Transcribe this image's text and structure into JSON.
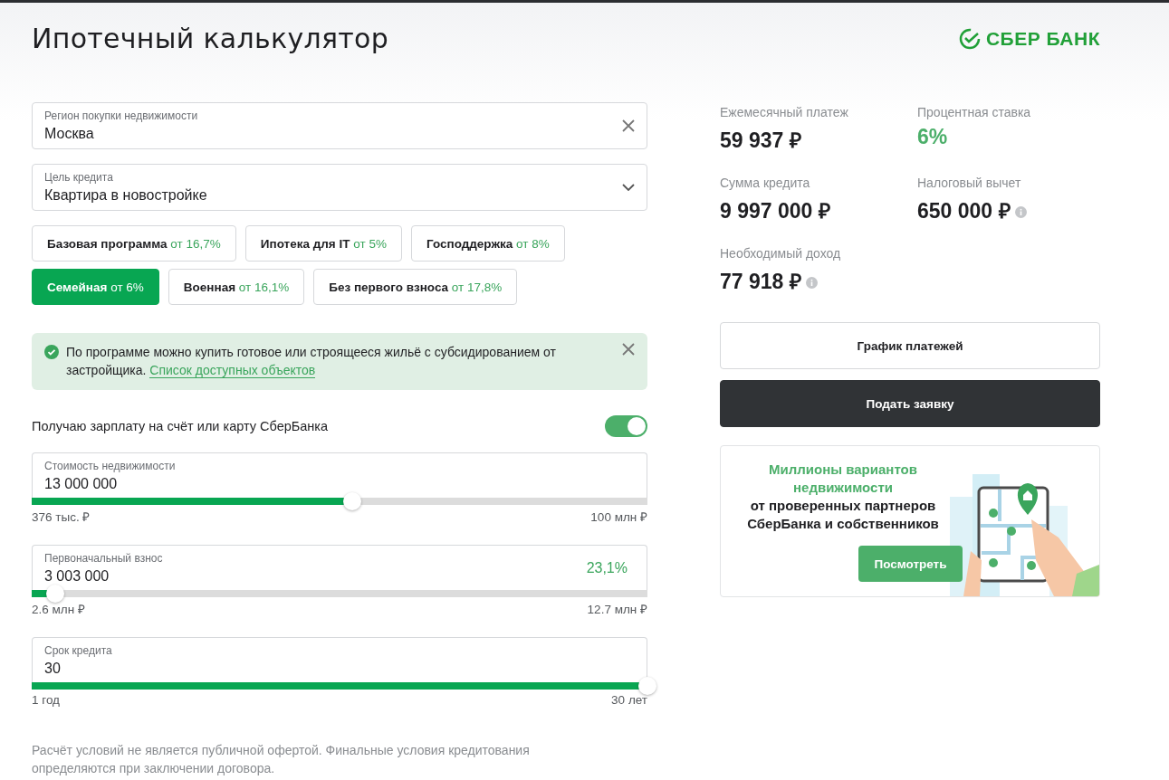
{
  "header": {
    "title": "Ипотечный калькулятор",
    "logo": "СБЕР БАНК"
  },
  "region_field": {
    "label": "Регион покупки недвижимости",
    "value": "Москва"
  },
  "purpose_field": {
    "label": "Цель кредита",
    "value": "Квартира в новостройке"
  },
  "programs": [
    {
      "name": "Базовая программа",
      "rate": "от 16,7%",
      "selected": false
    },
    {
      "name": "Ипотека для IT",
      "rate": "от 5%",
      "selected": false
    },
    {
      "name": "Господдержка",
      "rate": "от 8%",
      "selected": false
    },
    {
      "name": "Семейная",
      "rate": "от 6%",
      "selected": true
    },
    {
      "name": "Военная",
      "rate": "от 16,1%",
      "selected": false
    },
    {
      "name": "Без первого взноса",
      "rate": "от 17,8%",
      "selected": false
    }
  ],
  "notice": {
    "text": "По программе можно купить готовое или строящееся жильё с субсидированием от застройщика.",
    "link": "Список доступных объектов"
  },
  "salary_toggle": {
    "label": "Получаю зарплату на счёт или карту СберБанка",
    "on": true
  },
  "sliders": [
    {
      "label": "Стоимость недвижимости",
      "value": "13 000 000",
      "level": 0.52,
      "min": "376 тыс. ₽",
      "max": "100 млн ₽"
    },
    {
      "label": "Первоначальный взнос",
      "value": "3 003 000",
      "percent": "23,1%",
      "level": 0.038,
      "min": "2.6 млн ₽",
      "max": "12.7 млн ₽"
    },
    {
      "label": "Срок кредита",
      "value": "30",
      "level": 1,
      "min": "1 год",
      "max": "30 лет"
    }
  ],
  "disclaimer": "Расчёт условий не является публичной офертой. Финальные условия кредитования определяются при заключении договора.",
  "results": [
    {
      "label": "Ежемесячный платеж",
      "value": "59 937 ₽",
      "highlight": false,
      "info": false
    },
    {
      "label": "Процентная ставка",
      "value": "6%",
      "highlight": true,
      "info": false
    },
    {
      "label": "Сумма кредита",
      "value": "9 997 000 ₽",
      "highlight": false,
      "info": false
    },
    {
      "label": "Налоговый вычет",
      "value": "650 000 ₽",
      "highlight": false,
      "info": true
    },
    {
      "label": "Необходимый доход",
      "value": "77 918 ₽",
      "highlight": false,
      "info": true
    }
  ],
  "buttons": [
    {
      "label": "График платежей",
      "kind": "outline"
    },
    {
      "label": "Подать заявку",
      "kind": "dark"
    }
  ],
  "banner": {
    "title": "Миллионы вариантов недвижимости",
    "subtitle": "от проверенных партнеров СберБанка и собственников",
    "button": "Посмотреть"
  }
}
